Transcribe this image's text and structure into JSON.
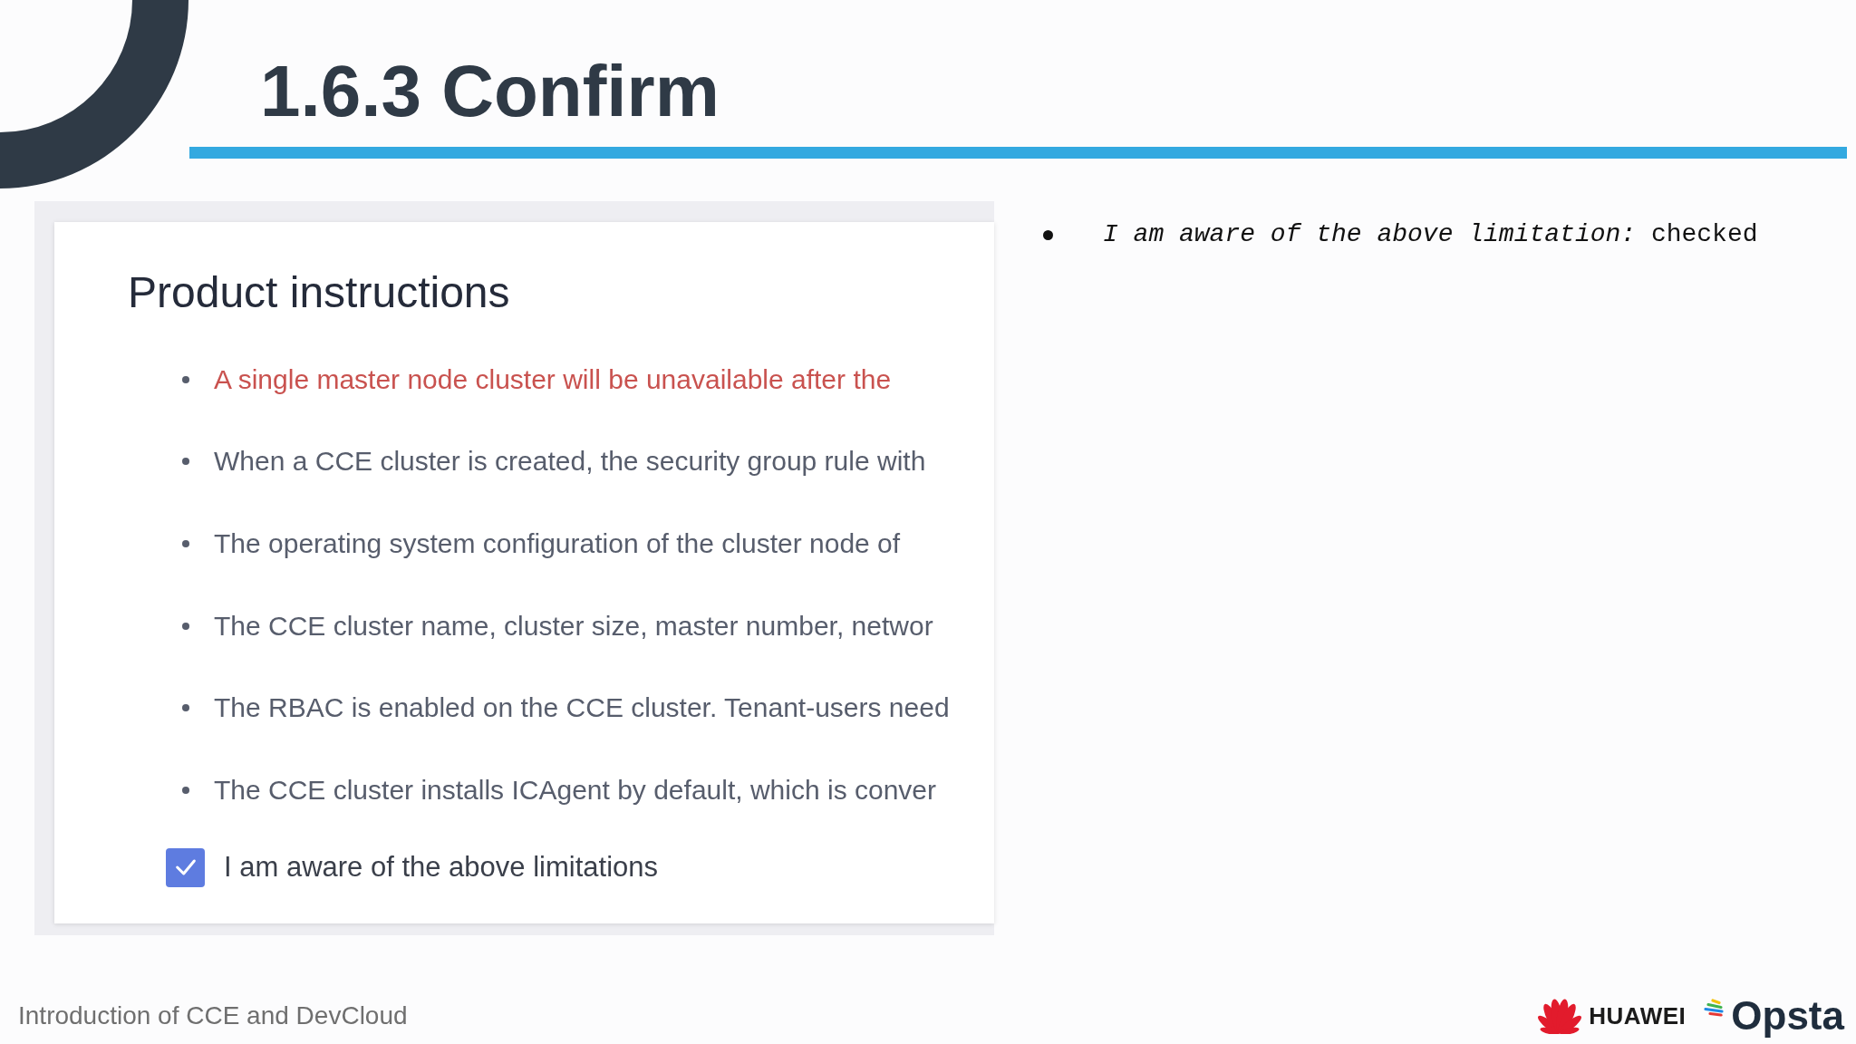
{
  "slide": {
    "title": "1.6.3 Confirm"
  },
  "screenshot": {
    "heading": "Product instructions",
    "items": [
      {
        "kind": "alert",
        "text": "A single master node cluster will be unavailable after the"
      },
      {
        "kind": "plain",
        "text": "When a CCE cluster is created, the security group rule with"
      },
      {
        "kind": "plain",
        "text": "The operating system configuration of the cluster node of"
      },
      {
        "kind": "plain",
        "text": "The CCE cluster name, cluster size, master number, networ"
      },
      {
        "kind": "plain",
        "text": "The RBAC is enabled on the CCE cluster. Tenant-users need"
      },
      {
        "kind": "plain",
        "text": "The CCE cluster installs ICAgent by default, which is conver"
      }
    ],
    "checkbox": {
      "label": "I am aware of the above limitations",
      "checked": true
    }
  },
  "notes": [
    "*I am aware of the above limitation:* checked"
  ],
  "footer": {
    "text": "Introduction of CCE and DevCloud",
    "logos": [
      {
        "kind": "petals",
        "text": "HUAWEI"
      },
      {
        "kind": "stripes",
        "text": "Opsta"
      }
    ]
  }
}
